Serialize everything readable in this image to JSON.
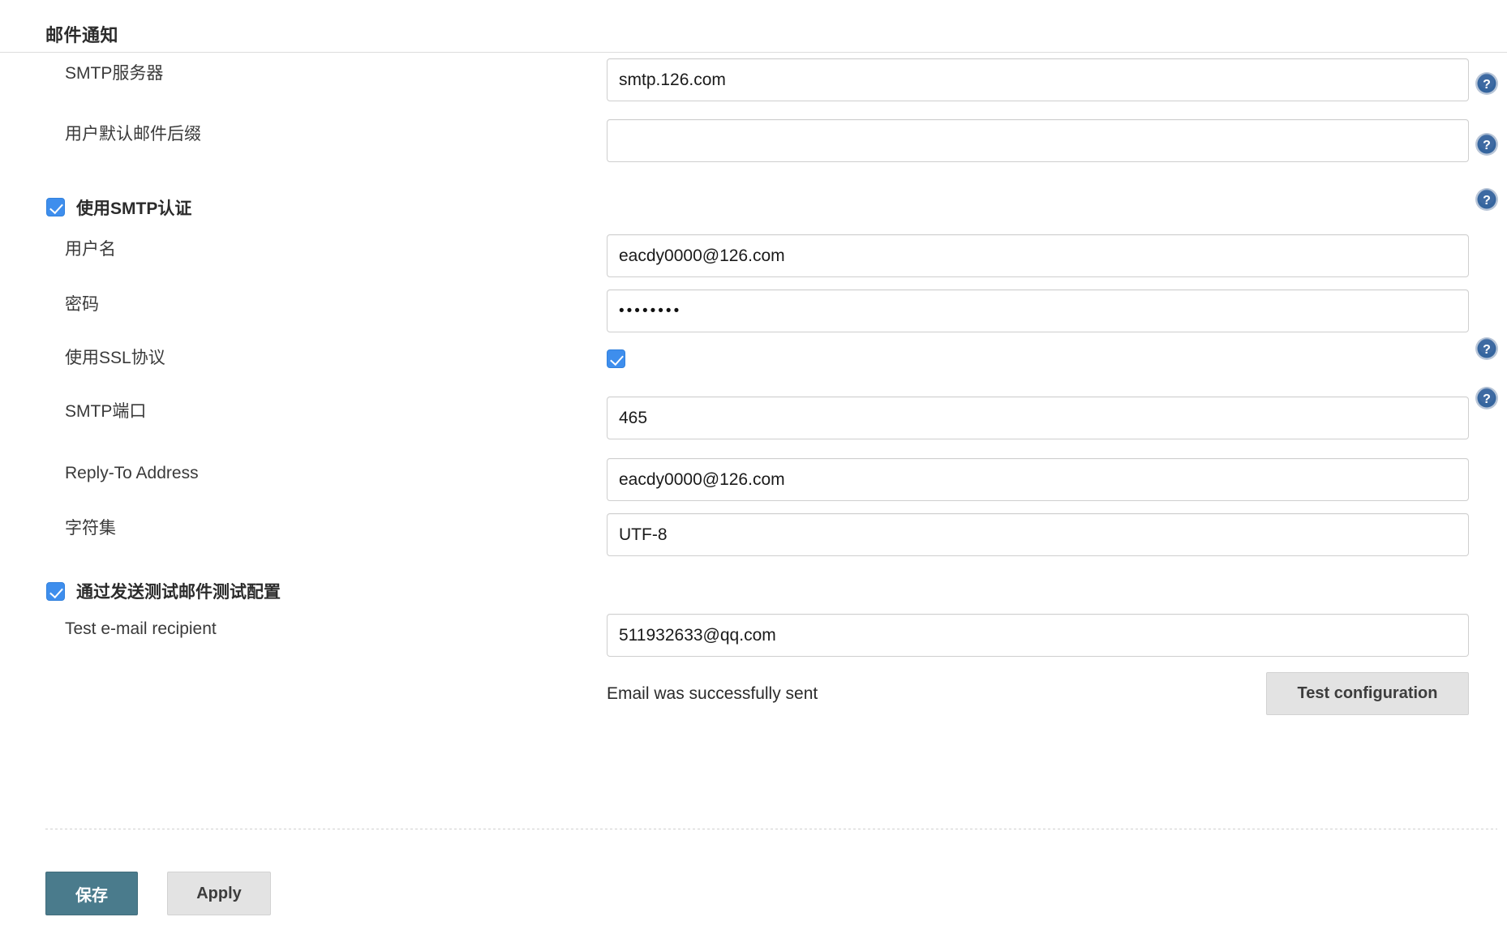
{
  "section": {
    "title": "邮件通知"
  },
  "fields": {
    "smtp_server": {
      "label": "SMTP服务器",
      "value": "smtp.126.com",
      "has_help": true
    },
    "default_suffix": {
      "label": "用户默认邮件后缀",
      "value": "",
      "has_help": true
    },
    "use_smtp_auth": {
      "label": "使用SMTP认证",
      "checked": true,
      "has_help": true
    },
    "username": {
      "label": "用户名",
      "value": "eacdy0000@126.com",
      "has_help": false
    },
    "password": {
      "label": "密码",
      "value": "••••••••",
      "has_help": false
    },
    "use_ssl": {
      "label": "使用SSL协议",
      "checked": true,
      "has_help": true
    },
    "smtp_port": {
      "label": "SMTP端口",
      "value": "465",
      "has_help": true
    },
    "reply_to": {
      "label": "Reply-To Address",
      "value": "eacdy0000@126.com",
      "has_help": false
    },
    "charset": {
      "label": "字符集",
      "value": "UTF-8",
      "has_help": false
    },
    "test_by_email": {
      "label": "通过发送测试邮件测试配置",
      "checked": true,
      "has_help": false
    },
    "test_recipient": {
      "label": "Test e-mail recipient",
      "value": "511932633@qq.com",
      "has_help": false
    }
  },
  "status": {
    "message": "Email was successfully sent"
  },
  "buttons": {
    "test_configuration": "Test configuration",
    "save": "保存",
    "apply": "Apply"
  },
  "icons": {
    "help": "help-icon"
  },
  "colors": {
    "checkbox_blue": "#3e8eed",
    "help_blue": "#35659e",
    "save_teal": "#4a7b8c",
    "button_grey": "#e3e3e3"
  }
}
